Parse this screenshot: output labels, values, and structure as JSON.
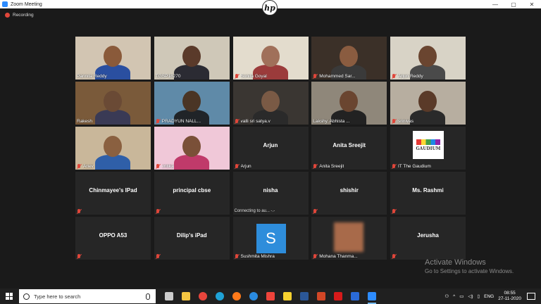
{
  "window": {
    "title": "Zoom Meeting",
    "controls": [
      "—",
      "▢",
      "✕"
    ],
    "hp_logo": "hp"
  },
  "recording": {
    "label": "Recording",
    "color": "#e0463a"
  },
  "gallery": {
    "active_speaker_color": "#c8e14b",
    "participants": [
      {
        "name": "Parinita Reddy",
        "video": true,
        "muted": false,
        "bg": "#d2c5b2",
        "skin": "#8a5a3a",
        "shirt": "#2a4fa0"
      },
      {
        "name": "TGSP18270",
        "video": true,
        "muted": false,
        "bg": "#cfc8b8",
        "skin": "#5a3a2a",
        "shirt": "#2b2b33"
      },
      {
        "name": "Sunita Goyal",
        "video": true,
        "muted": true,
        "bg": "#e3dccd",
        "skin": "#a0705a",
        "shirt": "#9b3b3b"
      },
      {
        "name": "Mohammed Sar...",
        "video": true,
        "muted": true,
        "bg": "#3b3028",
        "skin": "#8a5c40",
        "shirt": "#3a3a3a"
      },
      {
        "name": "Arjun Reddy",
        "video": true,
        "muted": true,
        "bg": "#d8d3c6",
        "skin": "#6a4530",
        "shirt": "#4a4a4a"
      },
      {
        "name": "Rakesh",
        "video": true,
        "muted": false,
        "bg": "#7a5a3a",
        "skin": "#6a4a35",
        "shirt": "#3a3a55"
      },
      {
        "name": "PRADYUN NALL...",
        "video": true,
        "muted": true,
        "bg": "#5f8aa8",
        "skin": "#4a3525",
        "shirt": "#202428"
      },
      {
        "name": "valli sri satya.v",
        "video": true,
        "muted": true,
        "bg": "#3a3632",
        "skin": "#7a5a45",
        "shirt": "#2a2a2a"
      },
      {
        "name": "Lakshy. Abhista ...",
        "video": true,
        "muted": false,
        "active": true,
        "bg": "#8f877a",
        "skin": "#6a4530",
        "shirt": "#222"
      },
      {
        "name": "srinivas",
        "video": true,
        "muted": true,
        "bg": "#b7aea0",
        "skin": "#5a3a28",
        "shirt": "#2a2a2a"
      },
      {
        "name": "Ariev",
        "video": true,
        "muted": true,
        "bg": "#c9b79a",
        "skin": "#8a6040",
        "shirt": "#2f5fa8"
      },
      {
        "name": "vritika",
        "video": true,
        "muted": true,
        "bg": "#f0c8d8",
        "skin": "#7a5038",
        "shirt": "#c03a6a"
      },
      {
        "name": "Arjun",
        "video": false,
        "muted": true,
        "display": "Arjun"
      },
      {
        "name": "Anita Sreejit",
        "video": false,
        "muted": true,
        "display": "Anita Sreejit"
      },
      {
        "name": "IT The Gaudium",
        "video": false,
        "muted": true,
        "avatar": "gaudium",
        "logo_text": "GAUDIUM"
      },
      {
        "name": "",
        "video": false,
        "muted": true,
        "display": "Chinmayee's IPad"
      },
      {
        "name": "",
        "video": false,
        "muted": true,
        "display": "principal cbse"
      },
      {
        "name": "",
        "video": false,
        "muted": false,
        "display": "nisha",
        "status": "Connecting to au... -.-"
      },
      {
        "name": "",
        "video": false,
        "muted": true,
        "display": "shishir"
      },
      {
        "name": "",
        "video": false,
        "muted": true,
        "display": "Ms. Rashmi"
      },
      {
        "name": "",
        "video": false,
        "muted": true,
        "display": "OPPO A53"
      },
      {
        "name": "",
        "video": false,
        "muted": true,
        "display": "Dilip's iPad"
      },
      {
        "name": "Sushmita Mishra",
        "video": false,
        "muted": true,
        "avatar": "letter",
        "letter": "S",
        "avatar_color": "#2e8ddb"
      },
      {
        "name": "Mohana Thanma...",
        "video": false,
        "muted": true,
        "avatar": "blur"
      },
      {
        "name": "",
        "video": false,
        "muted": true,
        "display": "Jerusha"
      }
    ]
  },
  "watermark": {
    "line1": "Activate Windows",
    "line2": "Go to Settings to activate Windows."
  },
  "taskbar": {
    "search_placeholder": "Type here to search",
    "apps": [
      {
        "icon": "task-view-icon",
        "color": "#cccccc"
      },
      {
        "icon": "file-explorer-icon",
        "color": "#f4c542"
      },
      {
        "icon": "chrome-icon",
        "color": "#e8453c"
      },
      {
        "icon": "edge-icon",
        "color": "#1fa2d6"
      },
      {
        "icon": "firefox-icon",
        "color": "#ff7a1a"
      },
      {
        "icon": "ie-icon",
        "color": "#2a8be0"
      },
      {
        "icon": "anydesk-icon",
        "color": "#ef443b"
      },
      {
        "icon": "sticky-notes-icon",
        "color": "#f7d12f"
      },
      {
        "icon": "word-icon",
        "color": "#2b5797"
      },
      {
        "icon": "powerpoint-icon",
        "color": "#d24726"
      },
      {
        "icon": "acrobat-icon",
        "color": "#d61a1a"
      },
      {
        "icon": "media-icon",
        "color": "#2a6ad8"
      },
      {
        "icon": "zoom-icon",
        "color": "#2d8cff",
        "running": true
      }
    ],
    "tray": {
      "language": "ENG",
      "time": "08:55",
      "date": "27-11-2020"
    }
  }
}
